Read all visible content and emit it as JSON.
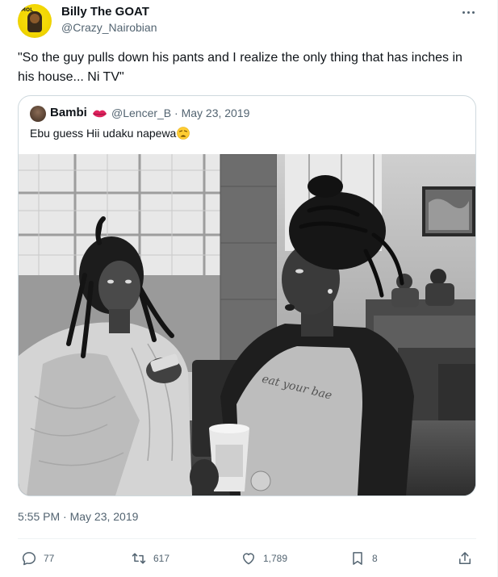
{
  "author": {
    "display_name": "Billy The GOAT",
    "handle": "@Crazy_Nairobian",
    "avatar_text": "MOL"
  },
  "tweet": {
    "text": "\"So the guy pulls down his pants and I realize the only thing that has inches in his house... Ni TV\"",
    "timestamp": "5:55 PM · May 23, 2019"
  },
  "quoted": {
    "display_name": "Bambi",
    "name_emoji": "lips-icon",
    "handle_date": "@Lencer_B · May 23, 2019",
    "text": "Ebu guess Hii udaku napewa",
    "text_emoji": "weary-face-icon",
    "photo_shirt_text": "eat your bae"
  },
  "actions": {
    "replies": "77",
    "retweets": "617",
    "likes": "1,789",
    "bookmarks": "8"
  },
  "colors": {
    "text": "#0f1419",
    "secondary": "#536471",
    "border": "#cfd9de",
    "lips": "#e0245e"
  }
}
